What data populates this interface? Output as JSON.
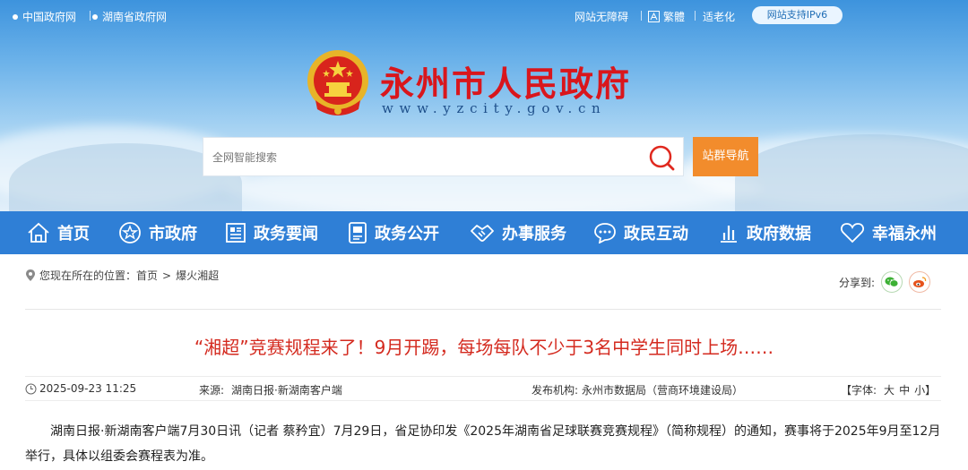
{
  "topbar": {
    "links": [
      "中国政府网",
      "湖南省政府网"
    ],
    "accessibility": "网站无障碍",
    "traditional": "繁體",
    "elderly": "适老化",
    "ipv6": "网站支持IPv6"
  },
  "header": {
    "title": "永州市人民政府",
    "url": "www.yzcity.gov.cn"
  },
  "search": {
    "placeholder": "全网智能搜索",
    "site_nav_label": "站群导航"
  },
  "mainnav": {
    "items": [
      {
        "label": "首页",
        "icon": "home-icon"
      },
      {
        "label": "市政府",
        "icon": "star-icon"
      },
      {
        "label": "政务要闻",
        "icon": "news-icon"
      },
      {
        "label": "政务公开",
        "icon": "document-icon"
      },
      {
        "label": "办事服务",
        "icon": "handshake-icon"
      },
      {
        "label": "政民互动",
        "icon": "chat-icon"
      },
      {
        "label": "政府数据",
        "icon": "bar-chart-icon"
      },
      {
        "label": "幸福永州",
        "icon": "heart-icon"
      }
    ]
  },
  "breadcrumb": {
    "prefix": "您现在所在的位置：",
    "home": "首页",
    "sep": ">",
    "current": "爆火湘超"
  },
  "share": {
    "label": "分享到:",
    "wechat_color": "#3cb034",
    "weibo_color": "#e6521c"
  },
  "article": {
    "title": "“湘超”竞赛规程来了！9月开踢，每场每队不少于3名中学生同时上场……",
    "date": "2025-09-23 11:25",
    "source_label": "来源:",
    "source": "湖南日报·新湖南客户端",
    "publisher_label": "发布机构:",
    "publisher": "永州市数据局（营商环境建设局）",
    "font_label": "【字体:",
    "font_large": "大",
    "font_medium": "中",
    "font_small": "小",
    "font_close": "】",
    "paragraph": "湖南日报·新湖南客户端7月30日讯（记者 蔡矜宜）7月29日，省足协印发《2025年湖南省足球联赛竞赛规程》（简称规程）的通知，赛事将于2025年9月至12月举行，具体以组委会赛程表为准。"
  },
  "colors": {
    "nav_bg": "#2f7fd6",
    "title_red": "#d9161c",
    "article_title": "#d42a1f",
    "orange_button": "#f28c2c"
  }
}
